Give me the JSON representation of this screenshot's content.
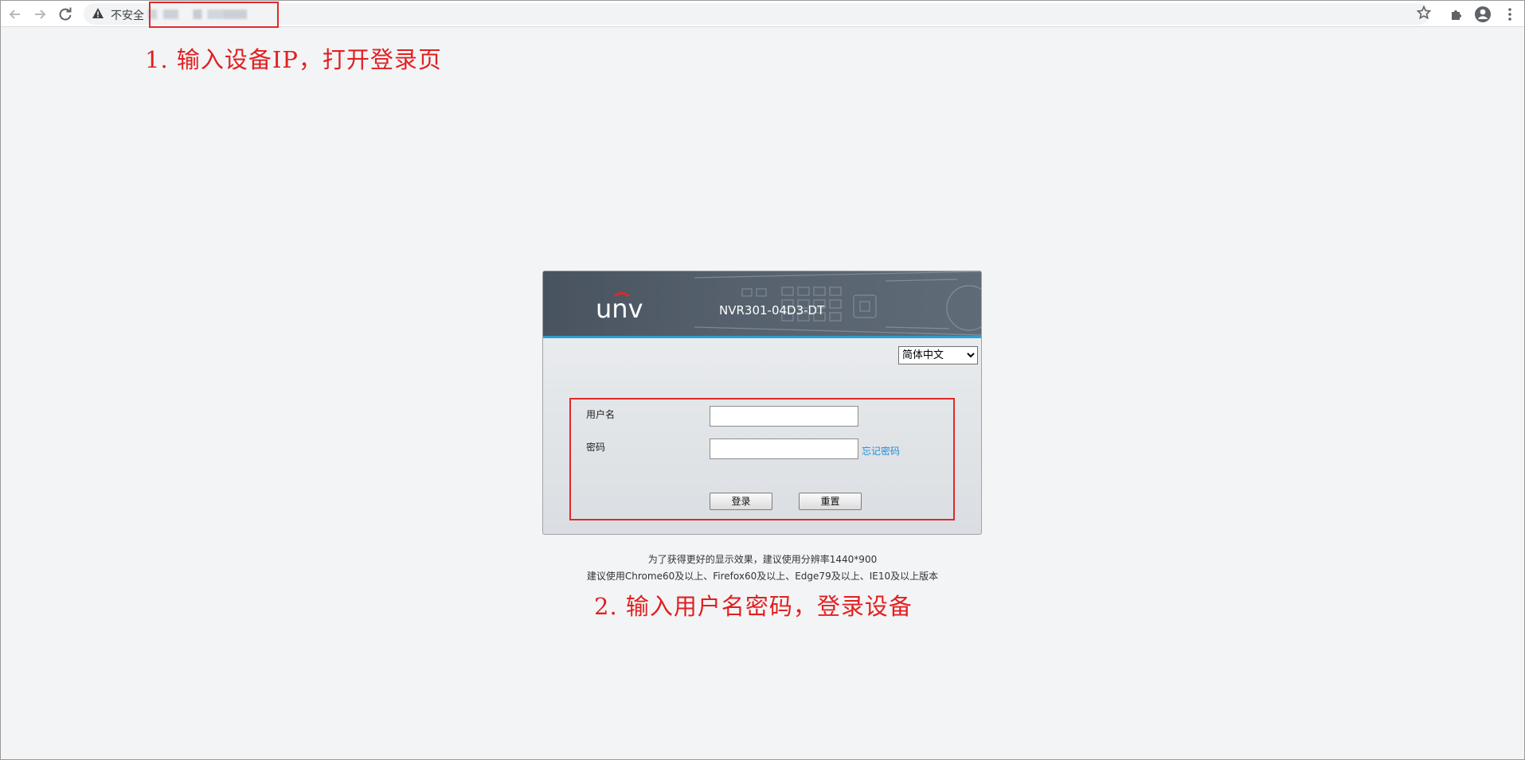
{
  "browser": {
    "security_label": "不安全",
    "icons": {
      "back": "arrow-left-icon",
      "forward": "arrow-right-icon",
      "reload": "reload-icon",
      "warning": "warning-triangle-icon",
      "bookmark": "star-icon",
      "extensions": "puzzle-icon",
      "profile": "account-circle-icon",
      "menu": "kebab-menu-icon"
    }
  },
  "annotations": {
    "step1": "1. 输入设备IP，打开登录页",
    "step2": "2. 输入用户名密码，登录设备",
    "color": "#e12020"
  },
  "login": {
    "brand": "unv",
    "model": "NVR301-04D3-DT",
    "language": {
      "selected": "简体中文"
    },
    "username_label": "用户名",
    "password_label": "密码",
    "username_value": "",
    "password_value": "",
    "forgot_password": "忘记密码",
    "login_button": "登录",
    "reset_button": "重置",
    "accent_color": "#2e9fd0"
  },
  "tips": {
    "line1": "为了获得更好的显示效果，建议使用分辨率1440*900",
    "line2": "建议使用Chrome60及以上、Firefox60及以上、Edge79及以上、IE10及以上版本"
  }
}
